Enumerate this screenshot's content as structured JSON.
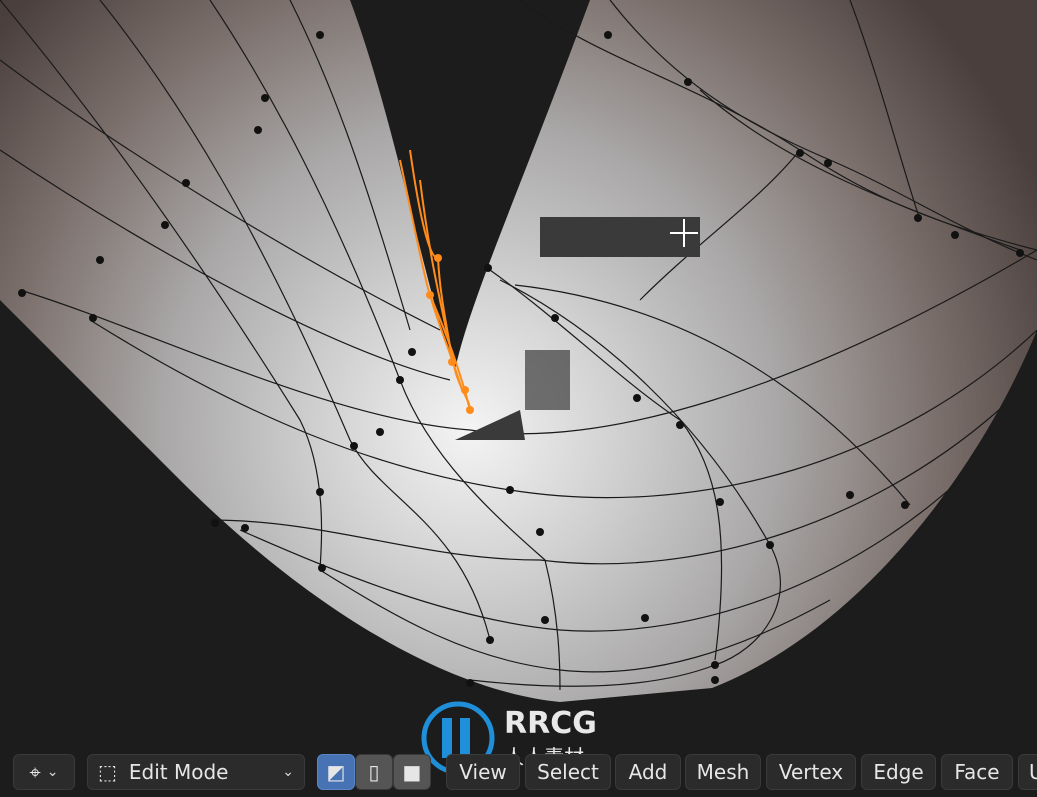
{
  "header": {
    "mode_label": "Edit Mode",
    "menus": [
      "View",
      "Select",
      "Add",
      "Mesh",
      "Vertex",
      "Edge",
      "Face",
      "U"
    ]
  },
  "icons": {
    "object_interaction": "object-interaction-icon",
    "edit_mode": "edit-mode-icon",
    "vertex_select": "vertex-select-icon",
    "edge_select": "edge-select-icon",
    "face_select": "face-select-icon"
  },
  "watermark": {
    "title": "RRCG",
    "subtitle": "人人素材"
  },
  "colors": {
    "accent": "#4772b3",
    "selection": "#ff8c1a",
    "background": "#1c1c1c"
  }
}
